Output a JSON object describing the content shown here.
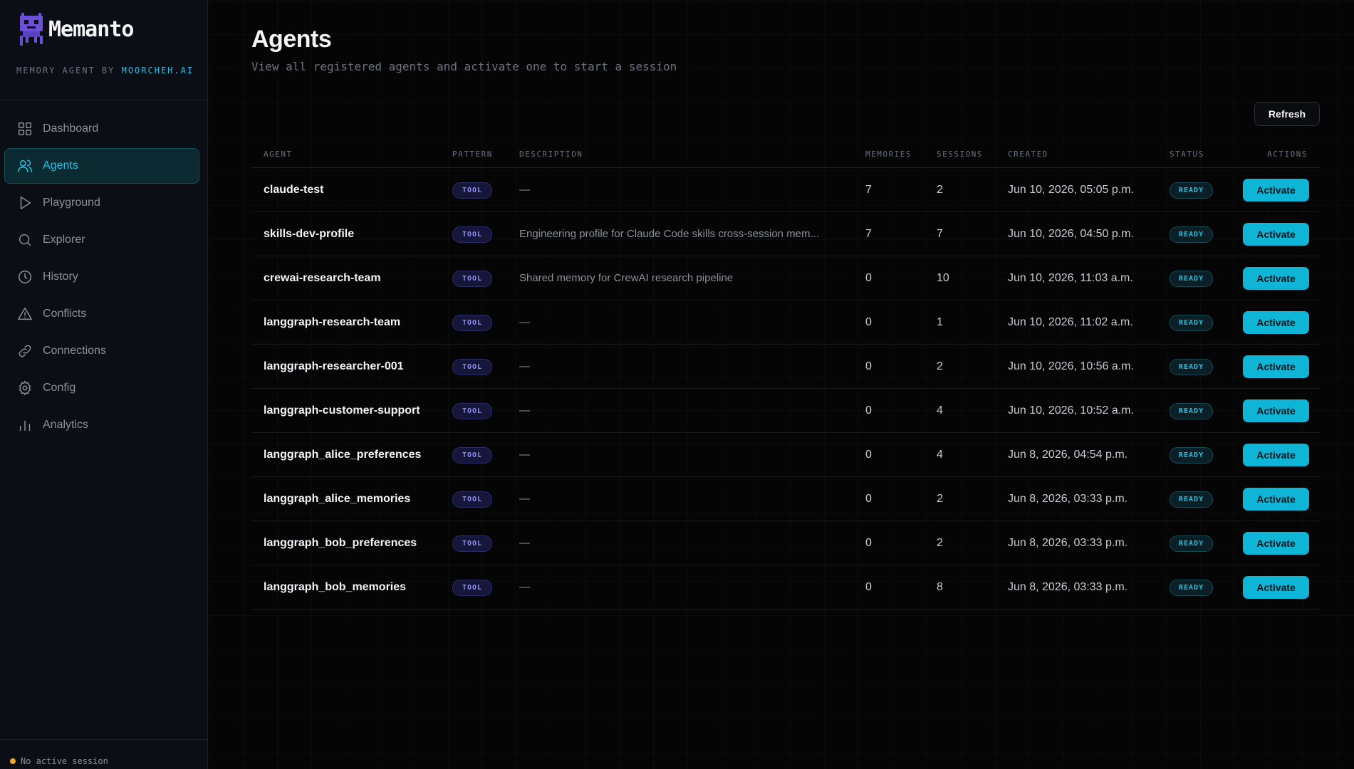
{
  "sidebar": {
    "brand_name": "Memanto",
    "brand_sub_prefix": "MEMORY AGENT BY ",
    "brand_sub_accent": "MOORCHEH.AI",
    "nav": [
      {
        "label": "Dashboard",
        "icon": "grid-icon"
      },
      {
        "label": "Agents",
        "icon": "users-icon",
        "active": true
      },
      {
        "label": "Playground",
        "icon": "play-icon"
      },
      {
        "label": "Explorer",
        "icon": "search-icon"
      },
      {
        "label": "History",
        "icon": "clock-icon"
      },
      {
        "label": "Conflicts",
        "icon": "alert-triangle-icon"
      },
      {
        "label": "Connections",
        "icon": "link-icon"
      },
      {
        "label": "Config",
        "icon": "gear-icon"
      },
      {
        "label": "Analytics",
        "icon": "bar-chart-icon"
      }
    ],
    "session_status": "No active session",
    "session_dot_color": "#f5a524"
  },
  "header": {
    "title": "Agents",
    "subtitle": "View all registered agents and activate one to start a session",
    "refresh_label": "Refresh"
  },
  "table": {
    "columns": {
      "agent": "AGENT",
      "pattern": "PATTERN",
      "description": "DESCRIPTION",
      "memories": "MEMORIES",
      "sessions": "SESSIONS",
      "created": "CREATED",
      "status": "STATUS",
      "actions": "ACTIONS"
    },
    "rows": [
      {
        "agent": "claude-test",
        "pattern": "TOOL",
        "description": "—",
        "memories": "7",
        "sessions": "2",
        "created": "Jun 10, 2026, 05:05 p.m.",
        "status": "READY",
        "action": "Activate"
      },
      {
        "agent": "skills-dev-profile",
        "pattern": "TOOL",
        "description": "Engineering profile for Claude Code skills cross-session mem...",
        "memories": "7",
        "sessions": "7",
        "created": "Jun 10, 2026, 04:50 p.m.",
        "status": "READY",
        "action": "Activate"
      },
      {
        "agent": "crewai-research-team",
        "pattern": "TOOL",
        "description": "Shared memory for CrewAI research pipeline",
        "memories": "0",
        "sessions": "10",
        "created": "Jun 10, 2026, 11:03 a.m.",
        "status": "READY",
        "action": "Activate"
      },
      {
        "agent": "langgraph-research-team",
        "pattern": "TOOL",
        "description": "—",
        "memories": "0",
        "sessions": "1",
        "created": "Jun 10, 2026, 11:02 a.m.",
        "status": "READY",
        "action": "Activate"
      },
      {
        "agent": "langgraph-researcher-001",
        "pattern": "TOOL",
        "description": "—",
        "memories": "0",
        "sessions": "2",
        "created": "Jun 10, 2026, 10:56 a.m.",
        "status": "READY",
        "action": "Activate"
      },
      {
        "agent": "langgraph-customer-support",
        "pattern": "TOOL",
        "description": "—",
        "memories": "0",
        "sessions": "4",
        "created": "Jun 10, 2026, 10:52 a.m.",
        "status": "READY",
        "action": "Activate"
      },
      {
        "agent": "langgraph_alice_preferences",
        "pattern": "TOOL",
        "description": "—",
        "memories": "0",
        "sessions": "4",
        "created": "Jun 8, 2026, 04:54 p.m.",
        "status": "READY",
        "action": "Activate"
      },
      {
        "agent": "langgraph_alice_memories",
        "pattern": "TOOL",
        "description": "—",
        "memories": "0",
        "sessions": "2",
        "created": "Jun 8, 2026, 03:33 p.m.",
        "status": "READY",
        "action": "Activate"
      },
      {
        "agent": "langgraph_bob_preferences",
        "pattern": "TOOL",
        "description": "—",
        "memories": "0",
        "sessions": "2",
        "created": "Jun 8, 2026, 03:33 p.m.",
        "status": "READY",
        "action": "Activate"
      },
      {
        "agent": "langgraph_bob_memories",
        "pattern": "TOOL",
        "description": "—",
        "memories": "0",
        "sessions": "8",
        "created": "Jun 8, 2026, 03:33 p.m.",
        "status": "READY",
        "action": "Activate"
      }
    ]
  },
  "colors": {
    "accent": "#22c3e6",
    "button": "#0fb5d6",
    "pattern_badge": "#8b8cf6",
    "logo": "#6b4fd6"
  }
}
